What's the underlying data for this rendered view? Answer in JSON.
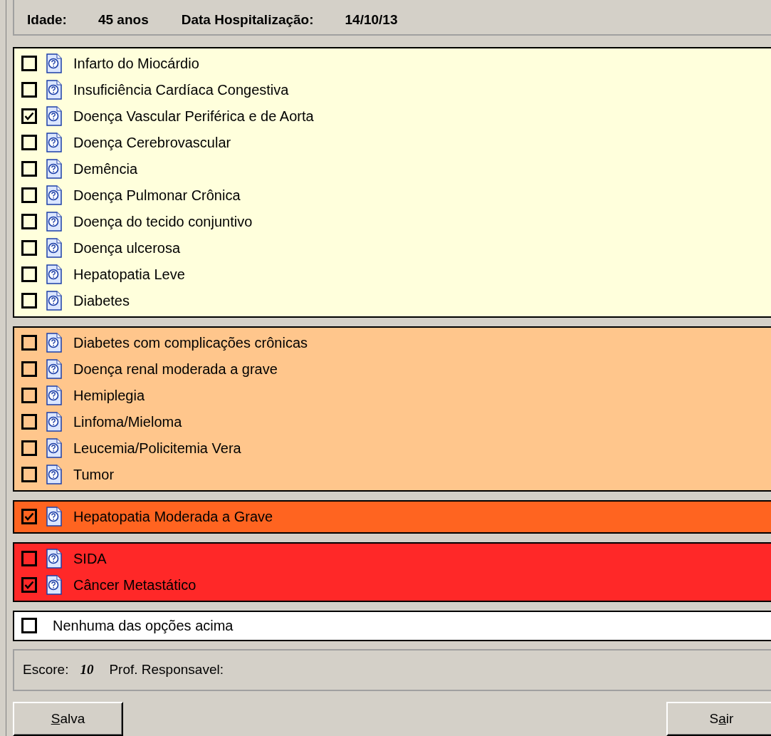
{
  "header": {
    "fields": [
      {
        "label": "Idade:",
        "value": "45 anos"
      },
      {
        "label": "Data Hospitalização:",
        "value": "14/10/13"
      }
    ]
  },
  "groups": [
    {
      "color": "#ffffdc",
      "items": [
        {
          "label": "Infarto do Miocárdio",
          "checked": false
        },
        {
          "label": "Insuficiência Cardíaca Congestiva",
          "checked": false
        },
        {
          "label": "Doença Vascular Periférica e de Aorta",
          "checked": true
        },
        {
          "label": "Doença Cerebrovascular",
          "checked": false
        },
        {
          "label": "Demência",
          "checked": false
        },
        {
          "label": "Doença Pulmonar Crônica",
          "checked": false
        },
        {
          "label": "Doença do tecido conjuntivo",
          "checked": false
        },
        {
          "label": "Doença ulcerosa",
          "checked": false
        },
        {
          "label": "Hepatopatia Leve",
          "checked": false
        },
        {
          "label": "Diabetes",
          "checked": false
        }
      ]
    },
    {
      "color": "#ffc68c",
      "items": [
        {
          "label": "Diabetes com complicações crônicas",
          "checked": false
        },
        {
          "label": "Doença renal moderada a grave",
          "checked": false
        },
        {
          "label": "Hemiplegia",
          "checked": false
        },
        {
          "label": "Linfoma/Mieloma",
          "checked": false
        },
        {
          "label": "Leucemia/Policitemia Vera",
          "checked": false
        },
        {
          "label": "Tumor",
          "checked": false
        }
      ]
    },
    {
      "color": "#ff6420",
      "items": [
        {
          "label": "Hepatopatia Moderada a Grave",
          "checked": true
        }
      ]
    },
    {
      "color": "#ff2828",
      "items": [
        {
          "label": "SIDA",
          "checked": false
        },
        {
          "label": "Câncer Metastático",
          "checked": true
        }
      ]
    }
  ],
  "none_option": {
    "label": "Nenhuma das opções acima",
    "checked": false
  },
  "footer": {
    "score_label": "Escore:",
    "score": "10",
    "responsible_label": "Prof. Responsavel:"
  },
  "buttons": [
    {
      "access_key": "S",
      "label_after": "alva"
    },
    {
      "label_before": "S",
      "access_key": "a",
      "label_after": "ir"
    }
  ]
}
